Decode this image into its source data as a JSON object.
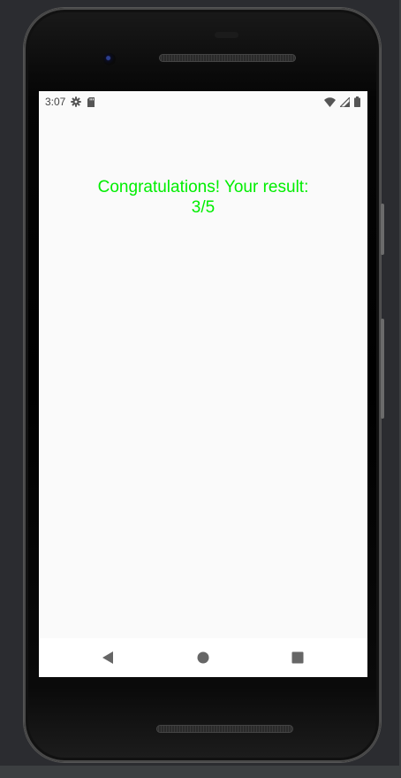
{
  "status_bar": {
    "time": "3:07",
    "left_icons": [
      "gear-icon",
      "sd-card-icon"
    ],
    "right_icons": [
      "wifi-icon",
      "cell-signal-icon",
      "battery-icon"
    ]
  },
  "main": {
    "result_message": "Congratulations! Your result: 3/5",
    "result_color": "#00ee00"
  },
  "nav_bar": {
    "buttons": [
      "back-icon",
      "home-icon",
      "recents-icon"
    ]
  }
}
